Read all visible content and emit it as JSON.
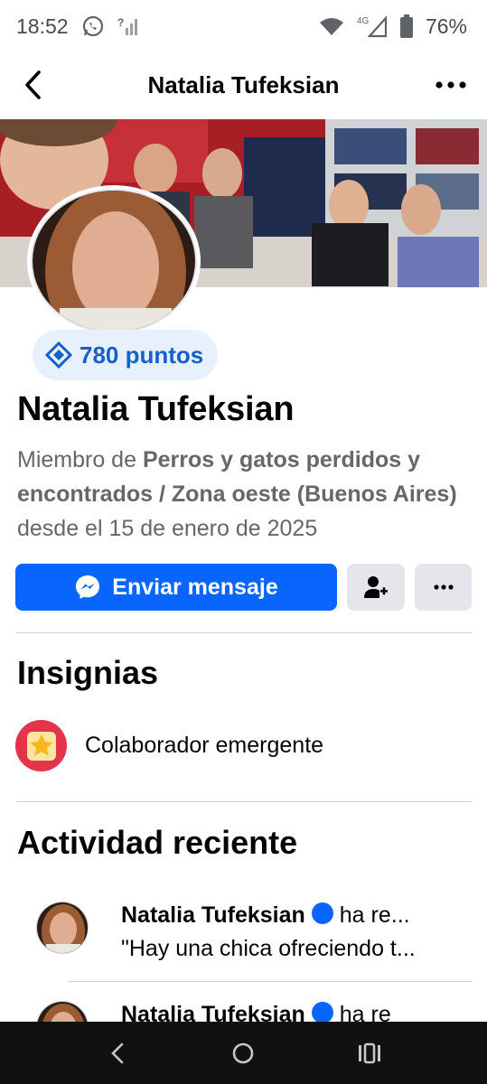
{
  "status_bar": {
    "time": "18:52",
    "network": "4G",
    "battery": "76%",
    "icons": [
      "whatsapp-icon",
      "signal-question-icon",
      "wifi-icon",
      "cell-signal-icon",
      "battery-icon"
    ]
  },
  "header": {
    "title": "Natalia Tufeksian",
    "back_icon": "chevron-left-icon",
    "more_icon": "ellipsis-icon"
  },
  "profile": {
    "points": "780 puntos",
    "name": "Natalia Tufeksian",
    "member_prefix": "Miembro de ",
    "group_name": "Perros y gatos perdidos y encontrados / Zona oeste (Buenos Aires)",
    "member_suffix": " desde el 15 de enero de 2025"
  },
  "actions": {
    "message_label": "Enviar mensaje"
  },
  "badges": {
    "title": "Insignias",
    "items": [
      {
        "label": "Colaborador emergente",
        "icon": "star-icon"
      }
    ]
  },
  "activity": {
    "title": "Actividad reciente",
    "items": [
      {
        "name": "Natalia Tufeksian",
        "action": "ha re...",
        "snippet": "\"Hay una chica ofreciendo t..."
      },
      {
        "name": "Natalia Tufeksian",
        "action": "ha re",
        "snippet": ""
      }
    ]
  },
  "colors": {
    "primary": "#0866ff",
    "badge_bg": "#e7f0fd",
    "badge_text": "#1461c9",
    "secondary_bg": "#e4e6eb",
    "muted_text": "#65676b"
  }
}
